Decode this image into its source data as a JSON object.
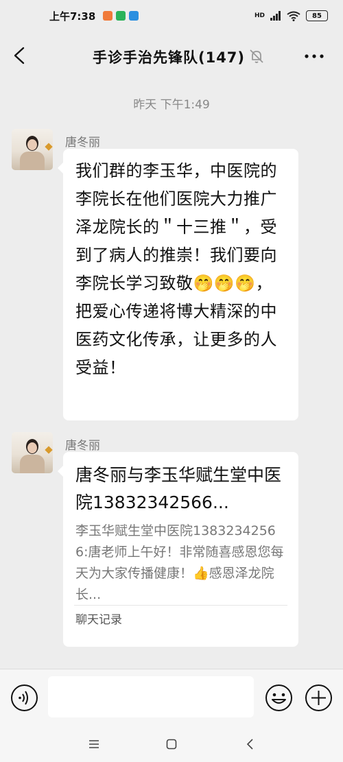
{
  "status_bar": {
    "time": "上午7:38",
    "network": "HD",
    "battery": "85",
    "app_icon_colors": [
      "#f07a3a",
      "#2bb35a",
      "#2a8fe0"
    ]
  },
  "nav": {
    "title": "手诊手治先锋队(147)",
    "icons": [
      "back-arrow",
      "bell-muted",
      "more-dots"
    ]
  },
  "timestamp": "昨天 下午1:49",
  "messages": [
    {
      "sender": "唐冬丽",
      "text": "我们群的李玉华，中医院的李院长在他们医院大力推广泽龙院长的＂十三推＂，受到了病人的推崇！我们要向李院长学习致敬🤭🤭🤭，把爱心传递将博大精深的中医药文化传承，让更多的人受益！"
    },
    {
      "sender": "唐冬丽",
      "card": {
        "title": "唐冬丽与李玉华赋生堂中医院13832342566...",
        "body": "李玉华赋生堂中医院13832342566:唐老师上午好！非常随喜感恩您每天为大家传播健康！👍感恩泽龙院长...",
        "footer": "聊天记录"
      }
    }
  ],
  "input_bar": {
    "placeholder": "",
    "icons": [
      "voice-icon",
      "emoji-icon",
      "plus-icon"
    ]
  },
  "system_nav": {
    "icons": [
      "menu-icon",
      "home-icon",
      "back-icon"
    ]
  }
}
